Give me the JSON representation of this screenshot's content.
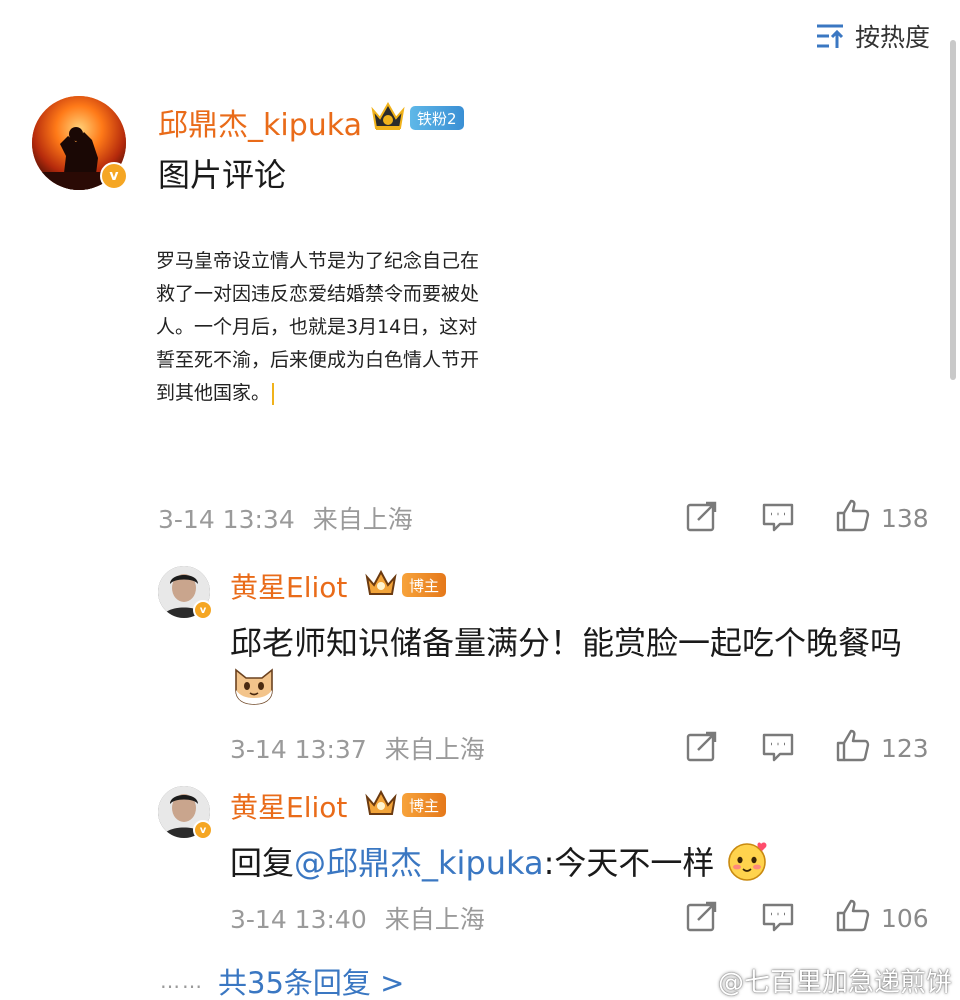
{
  "sort": {
    "label": "按热度",
    "icon": "sort-icon"
  },
  "main_comment": {
    "username": "邱鼎杰_kipuka",
    "badge_crown": "crown-icon",
    "badge_label": "铁粉2",
    "verified": true,
    "text": "图片评论",
    "image_text_lines": [
      "罗马皇帝设立情人节是为了纪念自己在",
      "救了一对因违反恋爱结婚禁令而要被处",
      "人。一个月后，也就是3月14日，这对",
      "誓至死不渝，后来便成为白色情人节开",
      "到其他国家。"
    ],
    "time": "3-14 13:34",
    "location": "来自上海",
    "likes": "138"
  },
  "replies": [
    {
      "username": "黄星Eliot",
      "badge_label": "博主",
      "text": "邱老师知识储备量满分！能赏脸一起吃个晚餐吗",
      "emoji": "cat-emoji",
      "time": "3-14 13:37",
      "location": "来自上海",
      "likes": "123"
    },
    {
      "username": "黄星Eliot",
      "badge_label": "博主",
      "reply_prefix": "回复",
      "mention": "@邱鼎杰_kipuka",
      "text": ":今天不一样",
      "emoji": "blush-emoji",
      "time": "3-14 13:40",
      "location": "来自上海",
      "likes": "106"
    }
  ],
  "more_replies": {
    "dots": "……",
    "label": "共35条回复 >"
  },
  "watermark": {
    "label": "@七百里加急递煎饼"
  },
  "colors": {
    "username": "#e96b19",
    "link": "#3a77c2",
    "meta": "#9a9a9a",
    "verified": "#f5a623"
  }
}
